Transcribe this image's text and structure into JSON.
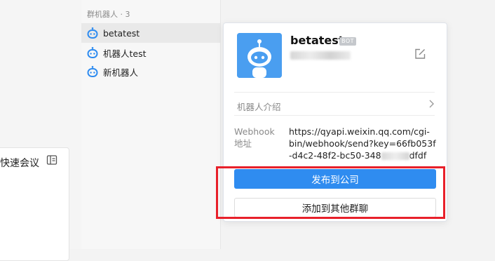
{
  "colors": {
    "accent": "#2f8cf0",
    "bot_icon": "#2f8cf0",
    "highlight_box": "#e8202a"
  },
  "left": {
    "meeting_label": "快速会议",
    "meeting_icon": "sidebar-panel-icon"
  },
  "group": {
    "header": "群机器人 · 3",
    "bots": [
      {
        "name": "betatest",
        "icon": "robot-icon",
        "selected": true
      },
      {
        "name": "机器人test",
        "icon": "robot-icon",
        "selected": false
      },
      {
        "name": "新机器人",
        "icon": "robot-icon",
        "selected": false
      }
    ]
  },
  "card": {
    "name": "betatest",
    "badge": "BOT",
    "intro_label": "机器人介绍",
    "webhook_label_1": "Webhook",
    "webhook_label_2": "地址",
    "webhook_line_1": "https://qyapi.weixin.qq.com/cgi-",
    "webhook_line_2": "bin/webhook/send?key=66fb053f",
    "webhook_line_3_start": "-d4c2-48f2-bc50-348",
    "webhook_line_3_end": "dfdf",
    "publish_button": "发布到公司",
    "add_group_button": "添加到其他群聊"
  }
}
